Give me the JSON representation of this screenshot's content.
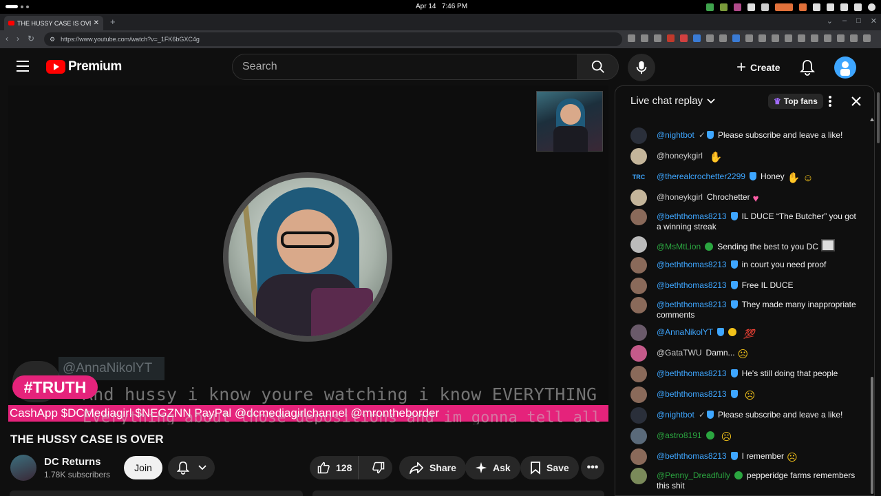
{
  "os": {
    "date": "Apr 14",
    "time": "7:46 PM"
  },
  "browser": {
    "tab_title": "THE HUSSY CASE IS OVER",
    "url": "https://www.youtube.com/watch?v=_1FK6bGXC4g"
  },
  "header": {
    "logo_text": "Premium",
    "search_placeholder": "Search",
    "create_label": "Create"
  },
  "player": {
    "tag": "#TRUTH",
    "overlay_name": "@AnnaNikolYT",
    "overlay_line1": "And hussy i know youre watching i know EVERYTHING that isn't police information.",
    "overlay_line2": "Everything about those depositions and im gonna tell all ur secrets u POS.",
    "banner": "CashApp $DCMediagirl $NEGZNN PayPal @dcmediagirlchannel @mrontheborder"
  },
  "video": {
    "title": "THE HUSSY CASE IS OVER",
    "channel": "DC Returns",
    "subscribers": "1.78K subscribers",
    "join_label": "Join",
    "likes": "128",
    "share_label": "Share",
    "ask_label": "Ask",
    "save_label": "Save"
  },
  "chat": {
    "title": "Live chat replay",
    "top_fans_label": "Top fans",
    "messages": [
      {
        "author": "@nightbot",
        "text": "Please subscribe and leave a like!"
      },
      {
        "author": "@honeykgirl",
        "text": ""
      },
      {
        "author": "@therealcrochetter2299",
        "text": "Honey"
      },
      {
        "author": "@honeykgirl",
        "text": "Chrochetter"
      },
      {
        "author": "@beththomas8213",
        "text": "IL DUCE “The Butcher” you got a winning streak"
      },
      {
        "author": "@MsMtLion",
        "text": "Sending the best to you DC"
      },
      {
        "author": "@beththomas8213",
        "text": "in court you need proof"
      },
      {
        "author": "@beththomas8213",
        "text": "Free IL DUCE"
      },
      {
        "author": "@beththomas8213",
        "text": "They made many inappropriate comments"
      },
      {
        "author": "@AnnaNikolYT",
        "text": ""
      },
      {
        "author": "@GataTWU",
        "text": "Damn..."
      },
      {
        "author": "@beththomas8213",
        "text": "He's still doing that people"
      },
      {
        "author": "@beththomas8213",
        "text": ""
      },
      {
        "author": "@nightbot",
        "text": "Please subscribe and leave a like!"
      },
      {
        "author": "@astro8191",
        "text": ""
      },
      {
        "author": "@beththomas8213",
        "text": "I remember"
      },
      {
        "author": "@Penny_Dreadfully",
        "text": "pepperidge farms remembers this shit"
      }
    ]
  },
  "colors": {
    "accent": "#3ea6ff",
    "brand": "#ff0000",
    "banner": "#e5237b",
    "member": "#2ba640"
  }
}
